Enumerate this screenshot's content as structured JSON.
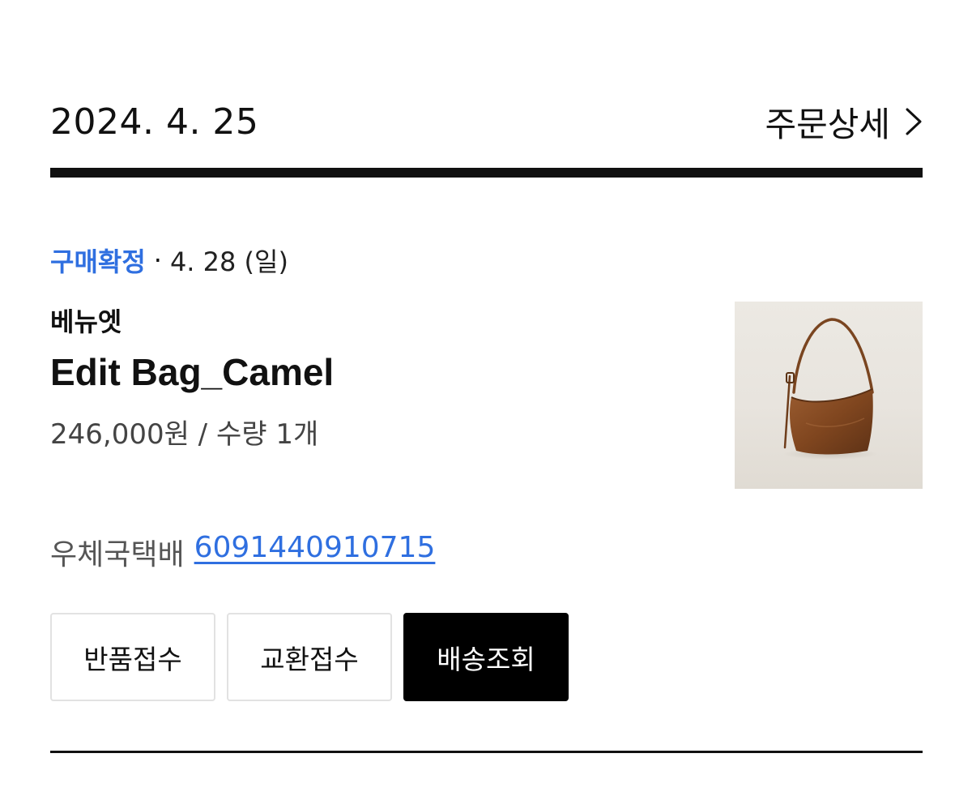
{
  "order": {
    "date": "2024. 4. 25",
    "detail_label": "주문상세"
  },
  "status": {
    "label": "구매확정",
    "separator": "·",
    "date": "4. 28 (일)",
    "color": "#2f6fe0"
  },
  "product": {
    "brand": "베뉴엣",
    "name": "Edit Bag_Camel",
    "price_qty": "246,000원 / 수량 1개",
    "image_icon": "leather-shoulder-bag-icon"
  },
  "shipping": {
    "courier": "우체국택배",
    "tracking_number": "6091440910715"
  },
  "actions": {
    "return_label": "반품접수",
    "exchange_label": "교환접수",
    "track_label": "배송조회"
  }
}
